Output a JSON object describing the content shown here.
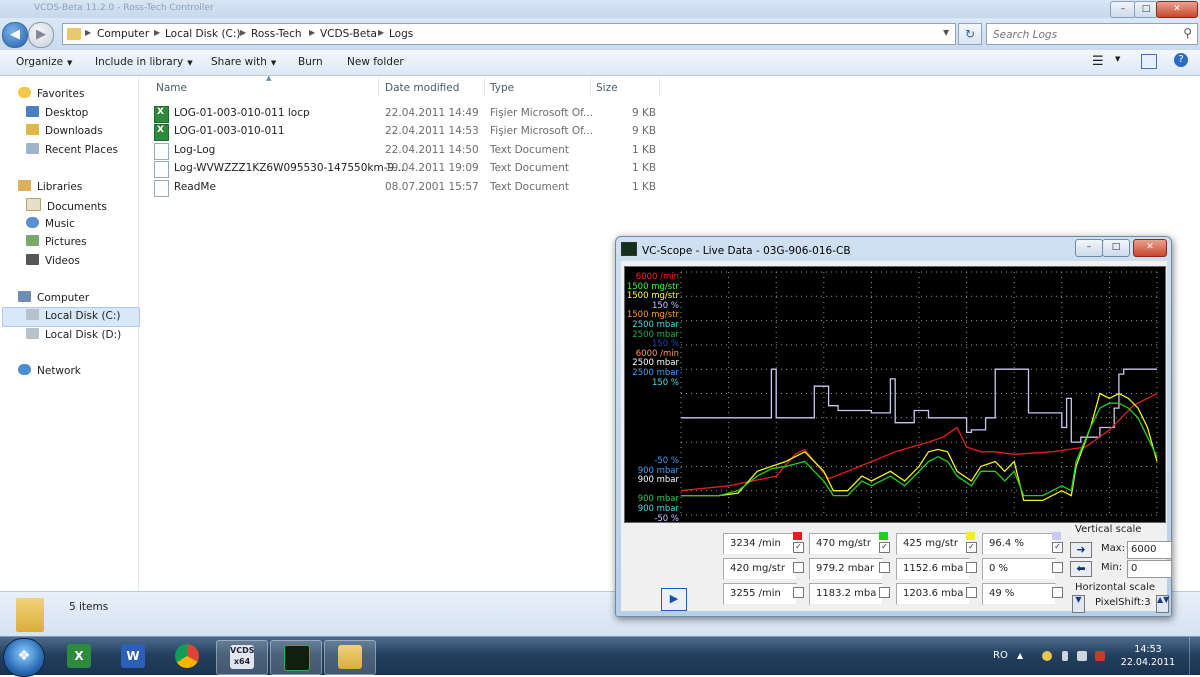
{
  "window": {
    "title": "VCDS-Beta 11.2.0 - Ross-Tech Controller",
    "buttons": [
      "–",
      "□",
      "✕"
    ]
  },
  "address": {
    "crumbs": [
      "Computer",
      "Local Disk (C:)",
      "Ross-Tech",
      "VCDS-Beta",
      "Logs"
    ],
    "search_placeholder": "Search Logs"
  },
  "toolbar": {
    "organize": "Organize",
    "include": "Include in library",
    "share": "Share with",
    "burn": "Burn",
    "newfolder": "New folder"
  },
  "nav": {
    "favorites": "Favorites",
    "desktop": "Desktop",
    "downloads": "Downloads",
    "recent": "Recent Places",
    "libraries": "Libraries",
    "documents": "Documents",
    "music": "Music",
    "pictures": "Pictures",
    "videos": "Videos",
    "computer": "Computer",
    "local_c": "Local Disk (C:)",
    "local_d": "Local Disk (D:)",
    "network": "Network"
  },
  "columns": {
    "name": "Name",
    "date": "Date modified",
    "type": "Type",
    "size": "Size"
  },
  "files": [
    {
      "name": "LOG-01-003-010-011  locp",
      "date": "22.04.2011 14:49",
      "type": "Fişier Microsoft Of...",
      "size": "9 KB",
      "icon": "excel-icon"
    },
    {
      "name": "LOG-01-003-010-011",
      "date": "22.04.2011 14:53",
      "type": "Fişier Microsoft Of...",
      "size": "9 KB",
      "icon": "excel-icon"
    },
    {
      "name": "Log-Log",
      "date": "22.04.2011 14:50",
      "type": "Text Document",
      "size": "1 KB",
      "icon": "text-file-icon"
    },
    {
      "name": "Log-WVWZZZ1KZ6W095530-147550km-9...",
      "date": "19.04.2011 19:09",
      "type": "Text Document",
      "size": "1 KB",
      "icon": "text-file-icon"
    },
    {
      "name": "ReadMe",
      "date": "08.07.2001 15:57",
      "type": "Text Document",
      "size": "1 KB",
      "icon": "text-file-icon"
    }
  ],
  "status": {
    "count": "5 items"
  },
  "taskbar": {
    "lang": "RO",
    "time": "14:53",
    "date": "22.04.2011",
    "vcds_label": "x64"
  },
  "scope": {
    "title": "VC-Scope  -  Live Data  -  03G-906-016-CB",
    "upper_labels": [
      {
        "text": "6000 /min",
        "color": "#ff2020"
      },
      {
        "text": "1500 mg/str",
        "color": "#30ff30"
      },
      {
        "text": "1500 mg/str",
        "color": "#ffff30"
      },
      {
        "text": "150 %",
        "color": "#c8c8ff"
      },
      {
        "text": "1500 mg/str",
        "color": "#ff9a20"
      },
      {
        "text": "2500 mbar",
        "color": "#40e0e0"
      },
      {
        "text": "2500 mbar",
        "color": "#20b050"
      },
      {
        "text": "150 %",
        "color": "#2040c0"
      },
      {
        "text": "6000 /min",
        "color": "#ff9a60"
      },
      {
        "text": "2500 mbar",
        "color": "#ffffff"
      },
      {
        "text": "2500 mbar",
        "color": "#40a0ff"
      },
      {
        "text": "150 %",
        "color": "#40e0e0"
      }
    ],
    "lower_labels": [
      {
        "text": "-50 %",
        "color": "#40a0ff"
      },
      {
        "text": "900 mbar",
        "color": "#40a0ff"
      },
      {
        "text": "900 mbar",
        "color": "#ffffff"
      },
      {
        "text": "",
        "color": "#000000"
      },
      {
        "text": "900 mbar",
        "color": "#20d050"
      },
      {
        "text": "900 mbar",
        "color": "#40e0e0"
      },
      {
        "text": "-50 %",
        "color": "#c8c8ff"
      }
    ],
    "values": [
      [
        "3234 /min",
        "470 mg/str",
        "425 mg/str",
        "96.4 %"
      ],
      [
        "420 mg/str",
        "979.2 mbar",
        "1152.6 mba",
        "0 %"
      ],
      [
        "3255 /min",
        "1183.2 mba",
        "1203.6 mba",
        "49 %"
      ]
    ],
    "swatch_colors": [
      "#e02020",
      "#20d020",
      "#f0f020",
      "#c8c8f0"
    ],
    "vertical_scale": "Vertical scale",
    "max_label": "Max:",
    "max_value": "6000",
    "min_label": "Min:",
    "min_value": "0",
    "horizontal_scale": "Horizontal scale",
    "pixelshift": "PixelShift:3"
  },
  "chart_data": {
    "type": "line",
    "title": "",
    "xlabel": "",
    "ylabel": "",
    "ylim": [
      0,
      100
    ],
    "grid": true,
    "series": [
      {
        "name": "",
        "color": "#c8c8f0",
        "values": [
          [
            0,
            40
          ],
          [
            10,
            40
          ],
          [
            19,
            40
          ],
          [
            19,
            60
          ],
          [
            20,
            60
          ],
          [
            20,
            40
          ],
          [
            28,
            40
          ],
          [
            28,
            53
          ],
          [
            31,
            53
          ],
          [
            31,
            45
          ],
          [
            33,
            45
          ],
          [
            33,
            43
          ],
          [
            40,
            43
          ],
          [
            40,
            42
          ],
          [
            44,
            42
          ],
          [
            44,
            56
          ],
          [
            45,
            56
          ],
          [
            45,
            38
          ],
          [
            49,
            38
          ],
          [
            49,
            43
          ],
          [
            52,
            43
          ],
          [
            52,
            40
          ],
          [
            56,
            40
          ],
          [
            56,
            40
          ],
          [
            60,
            40
          ],
          [
            60,
            34
          ],
          [
            61,
            34
          ],
          [
            61,
            35
          ],
          [
            64,
            35
          ],
          [
            64,
            40
          ],
          [
            66,
            40
          ],
          [
            66,
            60
          ],
          [
            69,
            60
          ],
          [
            69,
            60
          ],
          [
            73,
            60
          ],
          [
            73,
            42
          ],
          [
            76,
            42
          ],
          [
            76,
            42
          ],
          [
            80,
            42
          ],
          [
            80,
            36
          ],
          [
            81,
            36
          ],
          [
            81,
            48
          ],
          [
            82,
            48
          ],
          [
            82,
            30
          ],
          [
            84,
            30
          ],
          [
            84,
            32
          ],
          [
            86,
            32
          ],
          [
            86,
            32
          ],
          [
            88,
            32
          ],
          [
            88,
            36
          ],
          [
            91,
            36
          ],
          [
            91,
            44
          ],
          [
            92,
            44
          ],
          [
            92,
            58
          ],
          [
            93,
            58
          ],
          [
            93,
            60
          ],
          [
            100,
            60
          ]
        ]
      },
      {
        "name": "",
        "color": "#e02020",
        "values": [
          [
            0,
            10
          ],
          [
            10,
            12
          ],
          [
            20,
            16
          ],
          [
            24,
            25
          ],
          [
            26,
            27
          ],
          [
            28,
            22
          ],
          [
            31,
            15
          ],
          [
            35,
            18
          ],
          [
            45,
            26
          ],
          [
            52,
            30
          ],
          [
            55,
            32
          ],
          [
            58,
            36
          ],
          [
            60,
            28
          ],
          [
            63,
            26
          ],
          [
            66,
            26
          ],
          [
            70,
            25
          ],
          [
            78,
            26
          ],
          [
            85,
            28
          ],
          [
            90,
            35
          ],
          [
            95,
            45
          ],
          [
            100,
            50
          ]
        ]
      },
      {
        "name": "",
        "color": "#f0f020",
        "values": [
          [
            0,
            8
          ],
          [
            8,
            8
          ],
          [
            12,
            9
          ],
          [
            16,
            18
          ],
          [
            19,
            20
          ],
          [
            22,
            22
          ],
          [
            26,
            26
          ],
          [
            28,
            22
          ],
          [
            30,
            18
          ],
          [
            32,
            10
          ],
          [
            35,
            10
          ],
          [
            38,
            16
          ],
          [
            40,
            14
          ],
          [
            44,
            18
          ],
          [
            47,
            14
          ],
          [
            50,
            20
          ],
          [
            52,
            26
          ],
          [
            54,
            27
          ],
          [
            56,
            26
          ],
          [
            58,
            18
          ],
          [
            61,
            14
          ],
          [
            63,
            20
          ],
          [
            66,
            22
          ],
          [
            68,
            18
          ],
          [
            70,
            22
          ],
          [
            72,
            6
          ],
          [
            76,
            6
          ],
          [
            80,
            10
          ],
          [
            82,
            8
          ],
          [
            83,
            20
          ],
          [
            86,
            36
          ],
          [
            88,
            50
          ],
          [
            90,
            48
          ],
          [
            92,
            50
          ],
          [
            94,
            48
          ],
          [
            96,
            44
          ],
          [
            98,
            36
          ],
          [
            100,
            22
          ]
        ]
      },
      {
        "name": "",
        "color": "#20d020",
        "values": [
          [
            0,
            8
          ],
          [
            8,
            8
          ],
          [
            12,
            10
          ],
          [
            16,
            16
          ],
          [
            19,
            19
          ],
          [
            22,
            20
          ],
          [
            26,
            22
          ],
          [
            28,
            18
          ],
          [
            30,
            14
          ],
          [
            32,
            8
          ],
          [
            35,
            8
          ],
          [
            38,
            14
          ],
          [
            40,
            12
          ],
          [
            44,
            16
          ],
          [
            47,
            12
          ],
          [
            50,
            18
          ],
          [
            52,
            22
          ],
          [
            54,
            24
          ],
          [
            56,
            22
          ],
          [
            58,
            16
          ],
          [
            61,
            12
          ],
          [
            63,
            18
          ],
          [
            66,
            18
          ],
          [
            68,
            14
          ],
          [
            70,
            18
          ],
          [
            72,
            8
          ],
          [
            76,
            8
          ],
          [
            80,
            12
          ],
          [
            82,
            10
          ],
          [
            83,
            22
          ],
          [
            86,
            36
          ],
          [
            88,
            44
          ],
          [
            90,
            46
          ],
          [
            92,
            46
          ],
          [
            94,
            44
          ],
          [
            96,
            40
          ],
          [
            98,
            32
          ],
          [
            100,
            24
          ]
        ]
      }
    ]
  }
}
